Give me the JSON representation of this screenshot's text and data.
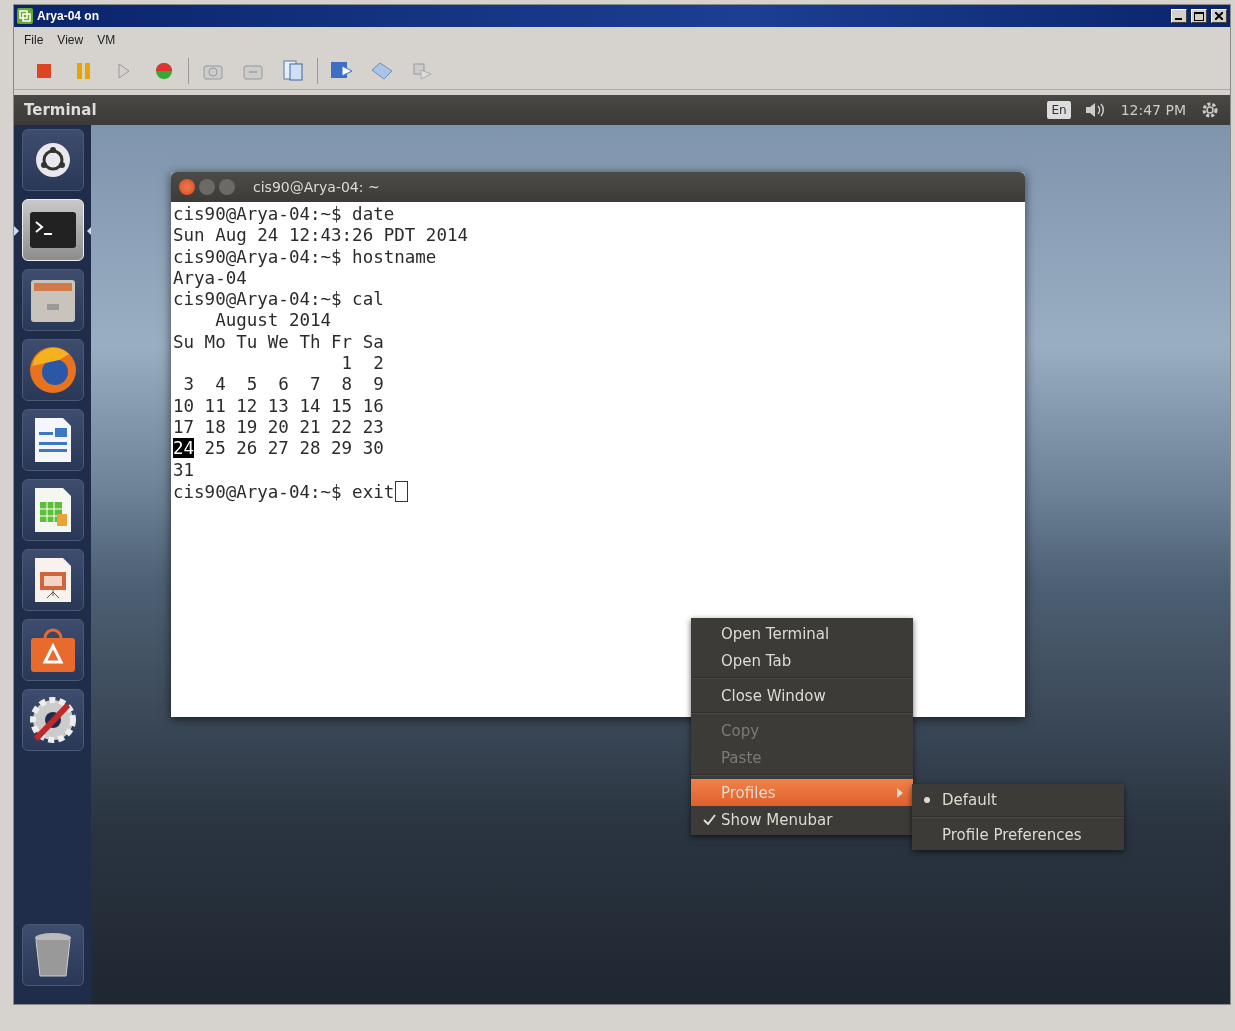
{
  "window": {
    "title": "Arya-04 on"
  },
  "menubar": [
    "File",
    "View",
    "VM"
  ],
  "toolbar": [
    {
      "kind": "stop"
    },
    {
      "kind": "pause"
    },
    {
      "kind": "play"
    },
    {
      "kind": "reset"
    },
    {
      "kind": "snapshot"
    },
    {
      "kind": "revert"
    },
    {
      "kind": "manager"
    },
    {
      "kind": "console"
    },
    {
      "kind": "fullscreen"
    },
    {
      "kind": "unity"
    }
  ],
  "top_panel": {
    "app_title": "Terminal",
    "keyboard": "En",
    "clock": "12:47 PM"
  },
  "launcher": [
    {
      "kind": "dash",
      "selected": false
    },
    {
      "kind": "terminal",
      "selected": true
    },
    {
      "kind": "files",
      "selected": false
    },
    {
      "kind": "browser",
      "selected": false
    },
    {
      "kind": "writer",
      "selected": false
    },
    {
      "kind": "calc",
      "selected": false
    },
    {
      "kind": "impress",
      "selected": false
    },
    {
      "kind": "store",
      "selected": false
    },
    {
      "kind": "settings",
      "selected": false
    },
    {
      "kind": "trash",
      "selected": false
    }
  ],
  "terminal": {
    "title": "cis90@Arya-04: ~",
    "cursor": true,
    "lines": [
      {
        "text": "cis90@Arya-04:~$ date"
      },
      {
        "text": "Sun Aug 24 12:43:26 PDT 2014"
      },
      {
        "text": "cis90@Arya-04:~$ hostname"
      },
      {
        "text": "Arya-04"
      },
      {
        "text": "cis90@Arya-04:~$ cal"
      },
      {
        "text": "    August 2014"
      },
      {
        "text": "Su Mo Tu We Th Fr Sa"
      },
      {
        "text": "                1  2"
      },
      {
        "text": " 3  4  5  6  7  8  9"
      },
      {
        "text": "10 11 12 13 14 15 16"
      },
      {
        "text": "17 18 19 20 21 22 23"
      },
      {
        "highlight": "24",
        "text": " 25 26 27 28 29 30"
      },
      {
        "text": "31"
      },
      {
        "text": "cis90@Arya-04:~$ exit"
      }
    ]
  },
  "context_menu": {
    "groups": [
      [
        {
          "label": "Open Terminal",
          "disabled": false,
          "selected": false,
          "checked": false,
          "kind": "item"
        },
        {
          "label": "Open Tab",
          "disabled": false,
          "selected": false,
          "checked": false,
          "kind": "item"
        }
      ],
      [
        {
          "label": "Close Window",
          "disabled": false,
          "selected": false,
          "checked": false,
          "kind": "item"
        }
      ],
      [
        {
          "label": "Copy",
          "disabled": true,
          "selected": false,
          "checked": false,
          "kind": "item"
        },
        {
          "label": "Paste",
          "disabled": true,
          "selected": false,
          "checked": false,
          "kind": "item"
        }
      ],
      [
        {
          "label": "Profiles",
          "disabled": false,
          "selected": true,
          "checked": false,
          "kind": "submenu"
        },
        {
          "label": "Show Menubar",
          "disabled": false,
          "selected": false,
          "checked": true,
          "kind": "item"
        }
      ]
    ]
  },
  "submenu": {
    "groups": [
      [
        {
          "label": "Default",
          "selected": true
        }
      ],
      [
        {
          "label": "Profile Preferences",
          "selected": false
        }
      ]
    ]
  }
}
